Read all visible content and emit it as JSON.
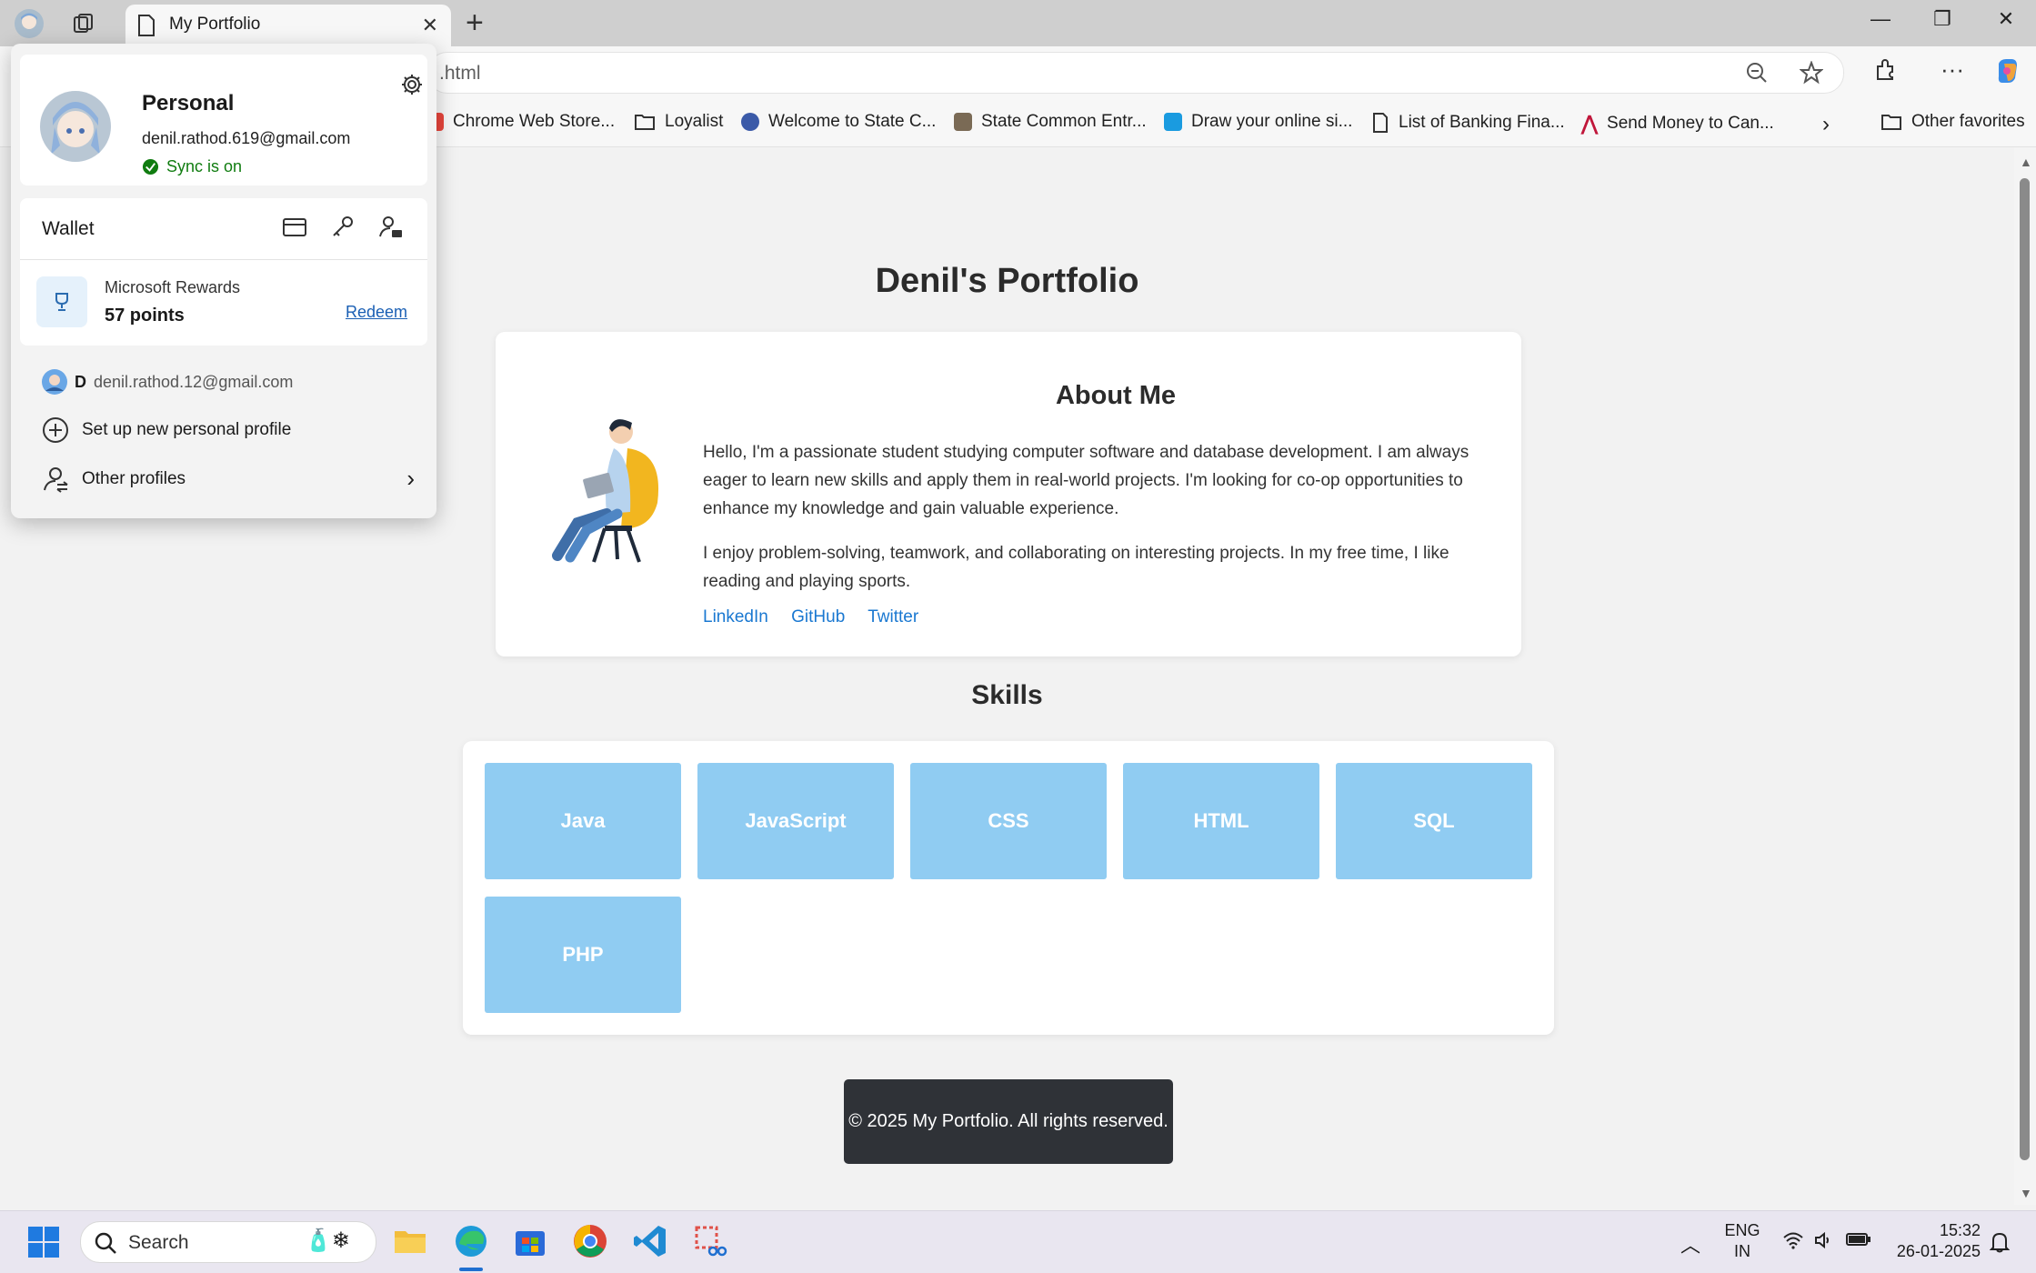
{
  "browser": {
    "tab_title": "My Portfolio",
    "address_partial": ".html",
    "bookmarks": [
      {
        "label": "Chrome Web Store...",
        "color": "#e8453c"
      },
      {
        "label": "Loyalist",
        "color": "folder"
      },
      {
        "label": "Welcome to State C...",
        "color": "#3b5aa8"
      },
      {
        "label": "State Common Entr...",
        "color": "#7a6a55"
      },
      {
        "label": "Draw your online si...",
        "color": "#1a9be0"
      },
      {
        "label": "List of Banking Fina...",
        "color": "page"
      },
      {
        "label": "Send Money to Can...",
        "color": "#c0163a"
      }
    ],
    "other_favorites": "Other favorites"
  },
  "page": {
    "title": "Denil's Portfolio",
    "about": {
      "heading": "About Me",
      "para1": "Hello, I'm a passionate student studying computer software and database development. I am always eager to learn new skills and apply them in real-world projects. I'm looking for co-op opportunities to enhance my knowledge and gain valuable experience.",
      "para2": "I enjoy problem-solving, teamwork, and collaborating on interesting projects. In my free time, I like reading and playing sports.",
      "links": [
        "LinkedIn",
        "GitHub",
        "Twitter"
      ]
    },
    "skills_heading": "Skills",
    "skills": [
      "Java",
      "JavaScript",
      "CSS",
      "HTML",
      "SQL",
      "PHP"
    ],
    "footer": "© 2025 My Portfolio. All rights reserved."
  },
  "profile": {
    "name": "Personal",
    "email": "denil.rathod.619@gmail.com",
    "sync": "Sync is on",
    "wallet": "Wallet",
    "rewards_title": "Microsoft Rewards",
    "rewards_points": "57 points",
    "redeem": "Redeem",
    "other_account_initial": "D",
    "other_account_email": "denil.rathod.12@gmail.com",
    "setup_profile": "Set up new personal profile",
    "other_profiles": "Other profiles"
  },
  "taskbar": {
    "search": "Search",
    "lang_top": "ENG",
    "lang_bottom": "IN",
    "time": "15:32",
    "date": "26-01-2025"
  }
}
